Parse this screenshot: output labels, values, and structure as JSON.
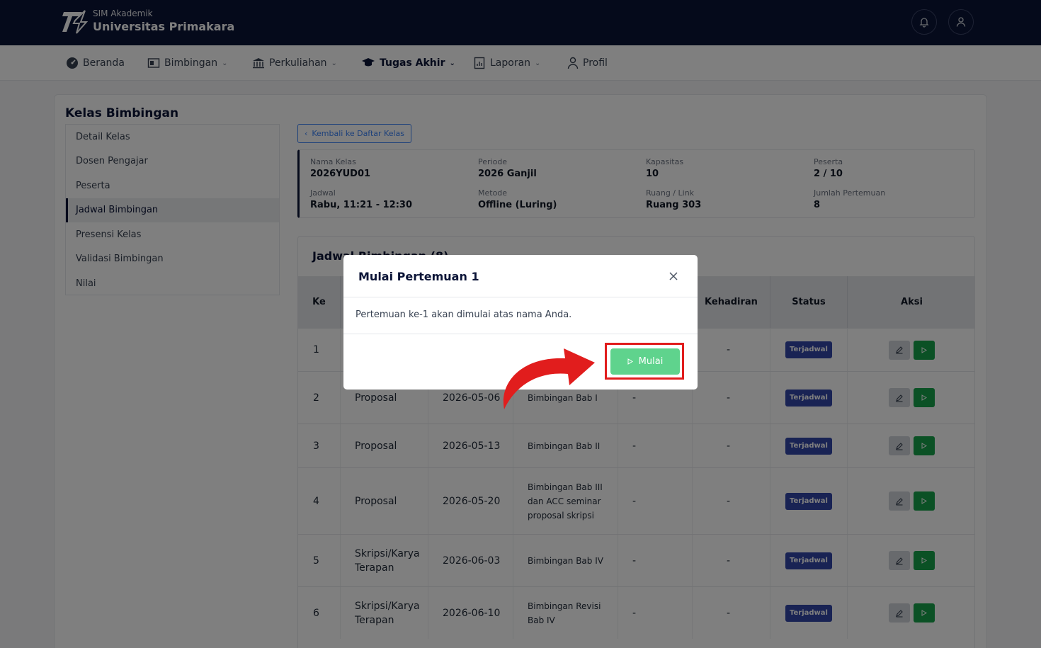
{
  "header": {
    "brand_sub": "SIM Akademik",
    "brand_main": "Universitas Primakara",
    "notification_icon": "bell-icon",
    "profile_icon": "user-icon",
    "bg_color": "#0b1437"
  },
  "nav": {
    "items": [
      {
        "label": "Beranda",
        "icon": "dashboard-icon",
        "dropdown": false
      },
      {
        "label": "Bimbingan",
        "icon": "board-icon",
        "dropdown": true
      },
      {
        "label": "Perkuliahan",
        "icon": "building-icon",
        "dropdown": true
      },
      {
        "label": "Tugas Akhir",
        "icon": "graduation-cap-icon",
        "dropdown": true,
        "active": true
      },
      {
        "label": "Laporan",
        "icon": "report-icon",
        "dropdown": true
      },
      {
        "label": "Profil",
        "icon": "user-icon",
        "dropdown": false
      }
    ]
  },
  "page": {
    "title": "Kelas Bimbingan",
    "back_button": "Kembali ke Daftar Kelas"
  },
  "sidebar": {
    "items": [
      {
        "label": "Detail Kelas"
      },
      {
        "label": "Dosen Pengajar"
      },
      {
        "label": "Peserta"
      },
      {
        "label": "Jadwal Bimbingan",
        "active": true
      },
      {
        "label": "Presensi Kelas"
      },
      {
        "label": "Validasi Bimbingan"
      },
      {
        "label": "Nilai"
      }
    ]
  },
  "info": {
    "nama_kelas_label": "Nama Kelas",
    "nama_kelas": "2026YUD01",
    "periode_label": "Periode",
    "periode": "2026 Ganjil",
    "kapasitas_label": "Kapasitas",
    "kapasitas": "10",
    "peserta_label": "Peserta",
    "peserta": "2 / 10",
    "jadwal_label": "Jadwal",
    "jadwal": "Rabu, 11:21 - 12:30",
    "metode_label": "Metode",
    "metode": "Offline (Luring)",
    "ruang_label": "Ruang / Link",
    "ruang": "Ruang 303",
    "jumlah_label": "Jumlah Pertemuan",
    "jumlah": "8"
  },
  "schedule": {
    "title": "Jadwal Bimbingan (8)",
    "headers": {
      "ke": "Ke",
      "kehadiran": "Kehadiran",
      "status": "Status",
      "aksi": "Aksi"
    },
    "rows": [
      {
        "ke": "1",
        "tahap": "",
        "tanggal": "",
        "materi": "",
        "c5": "",
        "kehadiran": "-",
        "status": "Terjadwal"
      },
      {
        "ke": "2",
        "tahap": "Proposal",
        "tanggal": "2026-05-06",
        "materi": "Bimbingan Bab I",
        "c5": "-",
        "kehadiran": "-",
        "status": "Terjadwal"
      },
      {
        "ke": "3",
        "tahap": "Proposal",
        "tanggal": "2026-05-13",
        "materi": "Bimbingan Bab II",
        "c5": "-",
        "kehadiran": "-",
        "status": "Terjadwal"
      },
      {
        "ke": "4",
        "tahap": "Proposal",
        "tanggal": "2026-05-20",
        "materi": "Bimbingan Bab III dan ACC seminar proposal skripsi",
        "c5": "-",
        "kehadiran": "-",
        "status": "Terjadwal"
      },
      {
        "ke": "5",
        "tahap": "Skripsi/Karya Terapan",
        "tanggal": "2026-06-03",
        "materi": "Bimbingan Bab IV",
        "c5": "-",
        "kehadiran": "-",
        "status": "Terjadwal"
      },
      {
        "ke": "6",
        "tahap": "Skripsi/Karya Terapan",
        "tanggal": "2026-06-10",
        "materi": "Bimbingan Revisi Bab IV",
        "c5": "-",
        "kehadiran": "-",
        "status": "Terjadwal"
      }
    ]
  },
  "modal": {
    "title": "Mulai Pertemuan 1",
    "body": "Pertemuan ke-1 akan dimulai atas nama Anda.",
    "start_label": "Mulai",
    "close_icon": "close-icon"
  },
  "colors": {
    "accent": "#0b1437",
    "success": "#16a34a",
    "badge": "#3346a8",
    "highlight": "#e11d1d"
  }
}
